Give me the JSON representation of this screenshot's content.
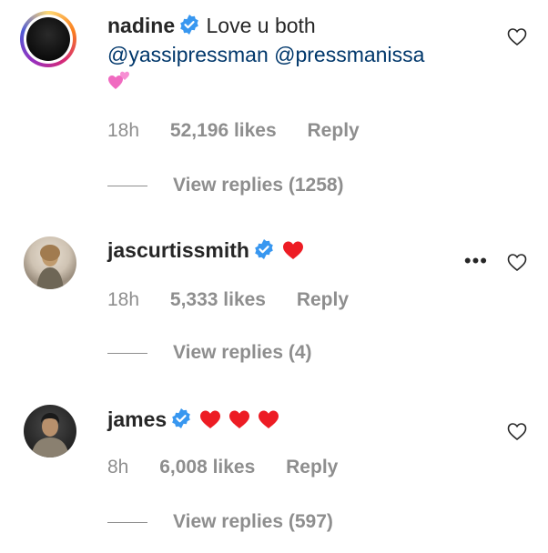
{
  "comments": [
    {
      "username": "nadine",
      "text": "Love u both",
      "mentions": [
        "@yassipressman",
        "@pressmanissa"
      ],
      "emoji": "pink-two-hearts",
      "time": "18h",
      "likes": "52,196 likes",
      "reply": "Reply",
      "view_replies": "View replies (1258)"
    },
    {
      "username": "jascurtissmith",
      "emoji": "red-heart",
      "time": "18h",
      "likes": "5,333 likes",
      "reply": "Reply",
      "view_replies": "View replies (4)"
    },
    {
      "username": "james",
      "emoji": "red-heart x3",
      "time": "8h",
      "likes": "6,008 likes",
      "reply": "Reply",
      "view_replies": "View replies (597)"
    }
  ],
  "colors": {
    "text": "#262626",
    "secondary": "#8e8e8e",
    "mention": "#00376b",
    "verified": "#3897f0",
    "heart_red": "#ed4956"
  }
}
